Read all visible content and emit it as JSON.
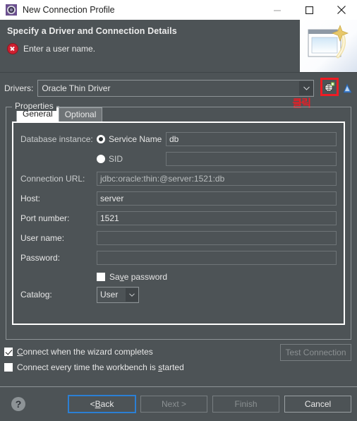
{
  "window": {
    "title": "New Connection Profile",
    "icon": "connection-profile-icon",
    "controls": {
      "minimize": "–",
      "maximize": "□",
      "close": "✕"
    }
  },
  "header": {
    "title": "Specify a Driver and Connection Details",
    "message": "Enter a user name.",
    "message_icon": "error-icon"
  },
  "drivers": {
    "label": "Drivers:",
    "selected": "Oracle Thin Driver",
    "new_driver_icon": "new-driver-definition-icon",
    "edit_driver_icon": "edit-driver-icon",
    "annotation": "클릭"
  },
  "properties": {
    "legend": "Properties",
    "tabs": [
      {
        "label": "General",
        "active": true
      },
      {
        "label": "Optional",
        "active": false
      }
    ],
    "fields": {
      "database_instance": {
        "label": "Database instance:",
        "options": [
          {
            "label": "Service Name",
            "selected": true,
            "value": "db"
          },
          {
            "label": "SID",
            "selected": false,
            "value": ""
          }
        ]
      },
      "connection_url": {
        "label": "Connection URL:",
        "value": "jdbc:oracle:thin:@server:1521:db",
        "readonly": true
      },
      "host": {
        "label": "Host:",
        "value": "server"
      },
      "port": {
        "label": "Port number:",
        "value": "1521"
      },
      "user_name": {
        "label": "User name:",
        "value": ""
      },
      "password": {
        "label": "Password:",
        "value": ""
      },
      "save_password": {
        "label_pre": "Sa",
        "label_mn": "v",
        "label_post": "e password",
        "checked": false
      },
      "catalog": {
        "label": "Catalog:",
        "value": "User"
      }
    }
  },
  "options": {
    "connect_on_complete": {
      "mn": "C",
      "rest": "onnect when the wizard completes",
      "checked": true
    },
    "connect_on_start": {
      "pre": "Connect every time the workbench is ",
      "mn": "s",
      "post": "tarted",
      "checked": false
    },
    "test_connection": {
      "label": "Test Connection",
      "enabled": false
    }
  },
  "bottom": {
    "help_icon": "help-icon",
    "buttons": [
      {
        "name": "back",
        "pre": "< ",
        "mn": "B",
        "post": "ack",
        "enabled": true,
        "focused": true
      },
      {
        "name": "next",
        "label": "Next >",
        "enabled": false,
        "focused": false
      },
      {
        "name": "finish",
        "label": "Finish",
        "enabled": false,
        "focused": false
      },
      {
        "name": "cancel",
        "label": "Cancel",
        "enabled": true,
        "focused": false
      }
    ]
  },
  "colors": {
    "dialog_bg": "#4d5356",
    "accent_red": "#ee1c24",
    "focus_blue": "#2b7fd4",
    "error_red": "#cf2030"
  }
}
